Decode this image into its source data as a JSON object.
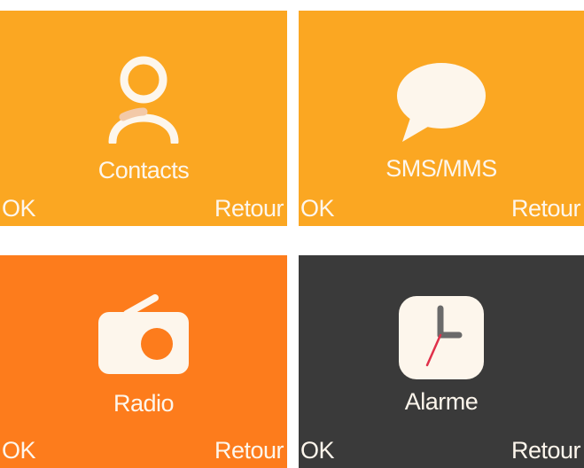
{
  "screens": [
    {
      "title": "Contacts",
      "icon": "person-icon",
      "ok": "OK",
      "back": "Retour",
      "background": "#fba722"
    },
    {
      "title": "SMS/MMS",
      "icon": "speech-bubble-icon",
      "ok": "OK",
      "back": "Retour",
      "background": "#fba722"
    },
    {
      "title": "Radio",
      "icon": "radio-icon",
      "ok": "OK",
      "back": "Retour",
      "background": "#fd7c1c"
    },
    {
      "title": "Alarme",
      "icon": "clock-icon",
      "ok": "OK",
      "back": "Retour",
      "background": "#3a3a3a"
    }
  ],
  "colors": {
    "text": "#fdf6ec",
    "clock_hand_red": "#e0304a",
    "clock_hand_gray": "#6a6a6a"
  }
}
